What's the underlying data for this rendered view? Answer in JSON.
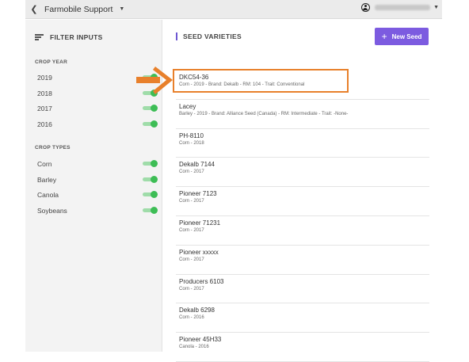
{
  "header": {
    "back_icon": "chevron-left-icon",
    "title": "Farmobile Support",
    "user_name": "••• •••• ••••"
  },
  "sidebar": {
    "title": "FILTER INPUTS",
    "crop_year": {
      "title": "CROP YEAR",
      "items": [
        {
          "label": "2019",
          "enabled": true
        },
        {
          "label": "2018",
          "enabled": true
        },
        {
          "label": "2017",
          "enabled": true
        },
        {
          "label": "2016",
          "enabled": true
        }
      ]
    },
    "crop_types": {
      "title": "CROP TYPES",
      "items": [
        {
          "label": "Corn",
          "enabled": true
        },
        {
          "label": "Barley",
          "enabled": true
        },
        {
          "label": "Canola",
          "enabled": true
        },
        {
          "label": "Soybeans",
          "enabled": true
        }
      ]
    }
  },
  "main": {
    "title": "SEED VARIETIES",
    "new_button": "New Seed",
    "seeds": [
      {
        "name": "DKC54-36",
        "detail": "Corn - 2019 - Brand: Dekalb - RM: 104 - Trait: Conventional"
      },
      {
        "name": "Lacey",
        "detail": "Barley - 2019 - Brand: Alliance Seed (Canada) - RM: Intermediate - Trait: -None-"
      },
      {
        "name": "PH-8110",
        "detail": "Corn - 2018"
      },
      {
        "name": "Dekalb 7144",
        "detail": "Corn - 2017"
      },
      {
        "name": "Pioneer 7123",
        "detail": "Corn - 2017"
      },
      {
        "name": "Pioneer 71231",
        "detail": "Corn - 2017"
      },
      {
        "name": "Pioneer xxxxx",
        "detail": "Corn - 2017"
      },
      {
        "name": "Producers 6103",
        "detail": "Corn - 2017"
      },
      {
        "name": "Dekalb 6298",
        "detail": "Corn - 2016"
      },
      {
        "name": "Pioneer 45H33",
        "detail": "Canola - 2016"
      }
    ]
  },
  "colors": {
    "accent": "#7c5be0",
    "toggle_on": "#3dbd55",
    "annotation": "#e8802b"
  }
}
